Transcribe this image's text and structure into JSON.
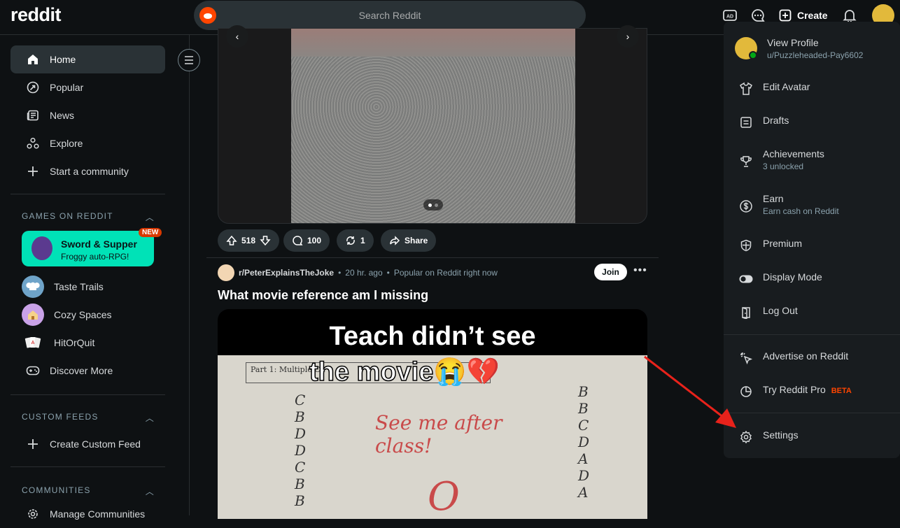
{
  "header": {
    "logo": "reddit",
    "search_placeholder": "Search Reddit",
    "create_label": "Create"
  },
  "sidebar": {
    "nav": [
      {
        "label": "Home",
        "icon": "home-icon"
      },
      {
        "label": "Popular",
        "icon": "popular-icon"
      },
      {
        "label": "News",
        "icon": "news-icon"
      },
      {
        "label": "Explore",
        "icon": "explore-icon"
      },
      {
        "label": "Start a community",
        "icon": "plus-icon"
      }
    ],
    "games_header": "GAMES ON REDDIT",
    "featured_game": {
      "title": "Sword & Supper",
      "subtitle": "Froggy auto-RPG!",
      "badge": "NEW"
    },
    "games": [
      {
        "label": "Taste Trails"
      },
      {
        "label": "Cozy Spaces"
      },
      {
        "label": "HitOrQuit"
      },
      {
        "label": "Discover More"
      }
    ],
    "custom_feeds_header": "CUSTOM FEEDS",
    "create_custom_feed": "Create Custom Feed",
    "communities_header": "COMMUNITIES",
    "manage_communities": "Manage Communities"
  },
  "post1": {
    "votes": "518",
    "comments": "100",
    "crossposts": "1",
    "share_label": "Share"
  },
  "post2": {
    "subreddit": "r/PeterExplainsTheJoke",
    "time": "20 hr. ago",
    "context": "Popular on Reddit right now",
    "join_label": "Join",
    "more_label": "•••",
    "title": "What movie reference am I missing",
    "caption_line1": "Teach didn’t see",
    "caption_line2": "the movie😭💔",
    "paper_heading": "Part 1: Multiple Ch",
    "paper_note": "See me after class!",
    "paper_grade": "O"
  },
  "profile_menu": {
    "view_profile": "View Profile",
    "username": "u/Puzzleheaded-Pay6602",
    "edit_avatar": "Edit Avatar",
    "drafts": "Drafts",
    "achievements": "Achievements",
    "achievements_sub": "3 unlocked",
    "earn": "Earn",
    "earn_sub": "Earn cash on Reddit",
    "premium": "Premium",
    "display_mode": "Display Mode",
    "log_out": "Log Out",
    "advertise": "Advertise on Reddit",
    "try_pro": "Try Reddit Pro",
    "beta": "BETA",
    "settings": "Settings"
  },
  "colors": {
    "background": "#0e1113",
    "accent": "#ff4500",
    "game_card": "#00e2b7",
    "annotation_arrow": "#e8221b"
  }
}
